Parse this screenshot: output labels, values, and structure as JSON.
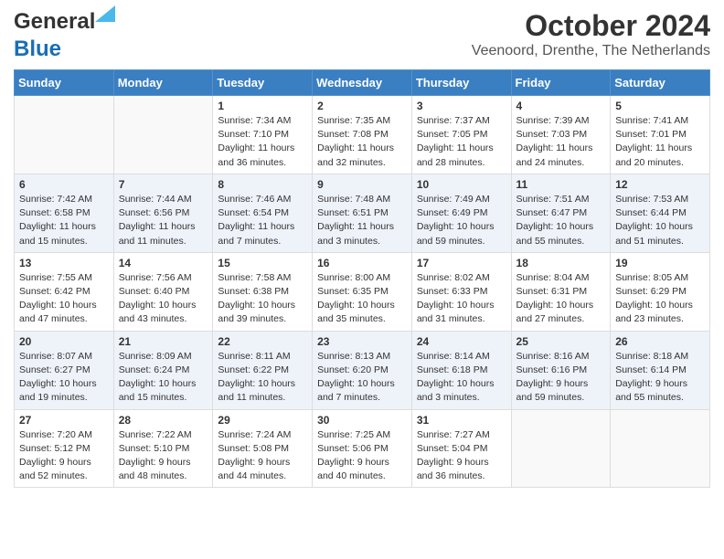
{
  "header": {
    "logo_line1": "General",
    "logo_line2": "Blue",
    "title": "October 2024",
    "subtitle": "Veenoord, Drenthe, The Netherlands"
  },
  "days_of_week": [
    "Sunday",
    "Monday",
    "Tuesday",
    "Wednesday",
    "Thursday",
    "Friday",
    "Saturday"
  ],
  "weeks": [
    [
      {
        "day": "",
        "info": ""
      },
      {
        "day": "",
        "info": ""
      },
      {
        "day": "1",
        "info": "Sunrise: 7:34 AM\nSunset: 7:10 PM\nDaylight: 11 hours and 36 minutes."
      },
      {
        "day": "2",
        "info": "Sunrise: 7:35 AM\nSunset: 7:08 PM\nDaylight: 11 hours and 32 minutes."
      },
      {
        "day": "3",
        "info": "Sunrise: 7:37 AM\nSunset: 7:05 PM\nDaylight: 11 hours and 28 minutes."
      },
      {
        "day": "4",
        "info": "Sunrise: 7:39 AM\nSunset: 7:03 PM\nDaylight: 11 hours and 24 minutes."
      },
      {
        "day": "5",
        "info": "Sunrise: 7:41 AM\nSunset: 7:01 PM\nDaylight: 11 hours and 20 minutes."
      }
    ],
    [
      {
        "day": "6",
        "info": "Sunrise: 7:42 AM\nSunset: 6:58 PM\nDaylight: 11 hours and 15 minutes."
      },
      {
        "day": "7",
        "info": "Sunrise: 7:44 AM\nSunset: 6:56 PM\nDaylight: 11 hours and 11 minutes."
      },
      {
        "day": "8",
        "info": "Sunrise: 7:46 AM\nSunset: 6:54 PM\nDaylight: 11 hours and 7 minutes."
      },
      {
        "day": "9",
        "info": "Sunrise: 7:48 AM\nSunset: 6:51 PM\nDaylight: 11 hours and 3 minutes."
      },
      {
        "day": "10",
        "info": "Sunrise: 7:49 AM\nSunset: 6:49 PM\nDaylight: 10 hours and 59 minutes."
      },
      {
        "day": "11",
        "info": "Sunrise: 7:51 AM\nSunset: 6:47 PM\nDaylight: 10 hours and 55 minutes."
      },
      {
        "day": "12",
        "info": "Sunrise: 7:53 AM\nSunset: 6:44 PM\nDaylight: 10 hours and 51 minutes."
      }
    ],
    [
      {
        "day": "13",
        "info": "Sunrise: 7:55 AM\nSunset: 6:42 PM\nDaylight: 10 hours and 47 minutes."
      },
      {
        "day": "14",
        "info": "Sunrise: 7:56 AM\nSunset: 6:40 PM\nDaylight: 10 hours and 43 minutes."
      },
      {
        "day": "15",
        "info": "Sunrise: 7:58 AM\nSunset: 6:38 PM\nDaylight: 10 hours and 39 minutes."
      },
      {
        "day": "16",
        "info": "Sunrise: 8:00 AM\nSunset: 6:35 PM\nDaylight: 10 hours and 35 minutes."
      },
      {
        "day": "17",
        "info": "Sunrise: 8:02 AM\nSunset: 6:33 PM\nDaylight: 10 hours and 31 minutes."
      },
      {
        "day": "18",
        "info": "Sunrise: 8:04 AM\nSunset: 6:31 PM\nDaylight: 10 hours and 27 minutes."
      },
      {
        "day": "19",
        "info": "Sunrise: 8:05 AM\nSunset: 6:29 PM\nDaylight: 10 hours and 23 minutes."
      }
    ],
    [
      {
        "day": "20",
        "info": "Sunrise: 8:07 AM\nSunset: 6:27 PM\nDaylight: 10 hours and 19 minutes."
      },
      {
        "day": "21",
        "info": "Sunrise: 8:09 AM\nSunset: 6:24 PM\nDaylight: 10 hours and 15 minutes."
      },
      {
        "day": "22",
        "info": "Sunrise: 8:11 AM\nSunset: 6:22 PM\nDaylight: 10 hours and 11 minutes."
      },
      {
        "day": "23",
        "info": "Sunrise: 8:13 AM\nSunset: 6:20 PM\nDaylight: 10 hours and 7 minutes."
      },
      {
        "day": "24",
        "info": "Sunrise: 8:14 AM\nSunset: 6:18 PM\nDaylight: 10 hours and 3 minutes."
      },
      {
        "day": "25",
        "info": "Sunrise: 8:16 AM\nSunset: 6:16 PM\nDaylight: 9 hours and 59 minutes."
      },
      {
        "day": "26",
        "info": "Sunrise: 8:18 AM\nSunset: 6:14 PM\nDaylight: 9 hours and 55 minutes."
      }
    ],
    [
      {
        "day": "27",
        "info": "Sunrise: 7:20 AM\nSunset: 5:12 PM\nDaylight: 9 hours and 52 minutes."
      },
      {
        "day": "28",
        "info": "Sunrise: 7:22 AM\nSunset: 5:10 PM\nDaylight: 9 hours and 48 minutes."
      },
      {
        "day": "29",
        "info": "Sunrise: 7:24 AM\nSunset: 5:08 PM\nDaylight: 9 hours and 44 minutes."
      },
      {
        "day": "30",
        "info": "Sunrise: 7:25 AM\nSunset: 5:06 PM\nDaylight: 9 hours and 40 minutes."
      },
      {
        "day": "31",
        "info": "Sunrise: 7:27 AM\nSunset: 5:04 PM\nDaylight: 9 hours and 36 minutes."
      },
      {
        "day": "",
        "info": ""
      },
      {
        "day": "",
        "info": ""
      }
    ]
  ]
}
